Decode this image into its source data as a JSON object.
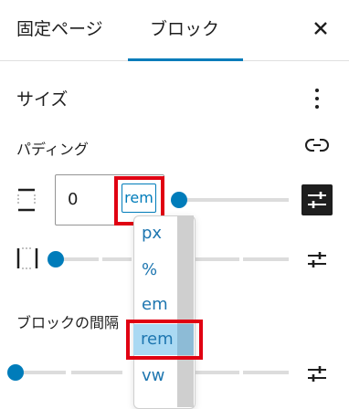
{
  "tabs": [
    {
      "label": "固定ページ"
    },
    {
      "label": "ブロック"
    }
  ],
  "section": {
    "title": "サイズ",
    "padding_label": "パディング",
    "block_spacing_label": "ブロックの間隔"
  },
  "padding": {
    "value": "0",
    "unit": "rem",
    "slider_fraction": 0
  },
  "unit_options": [
    "px",
    "%",
    "em",
    "rem",
    "vw"
  ],
  "selected_unit": "rem",
  "colors": {
    "accent": "#007cba",
    "highlight": "#e00012",
    "selected_bg": "#aad9f3"
  },
  "icons": [
    "close-icon",
    "kebab-menu-icon",
    "link-unlink-icon",
    "side-vertical-icon",
    "side-horizontal-icon",
    "settings-sliders-icon"
  ]
}
